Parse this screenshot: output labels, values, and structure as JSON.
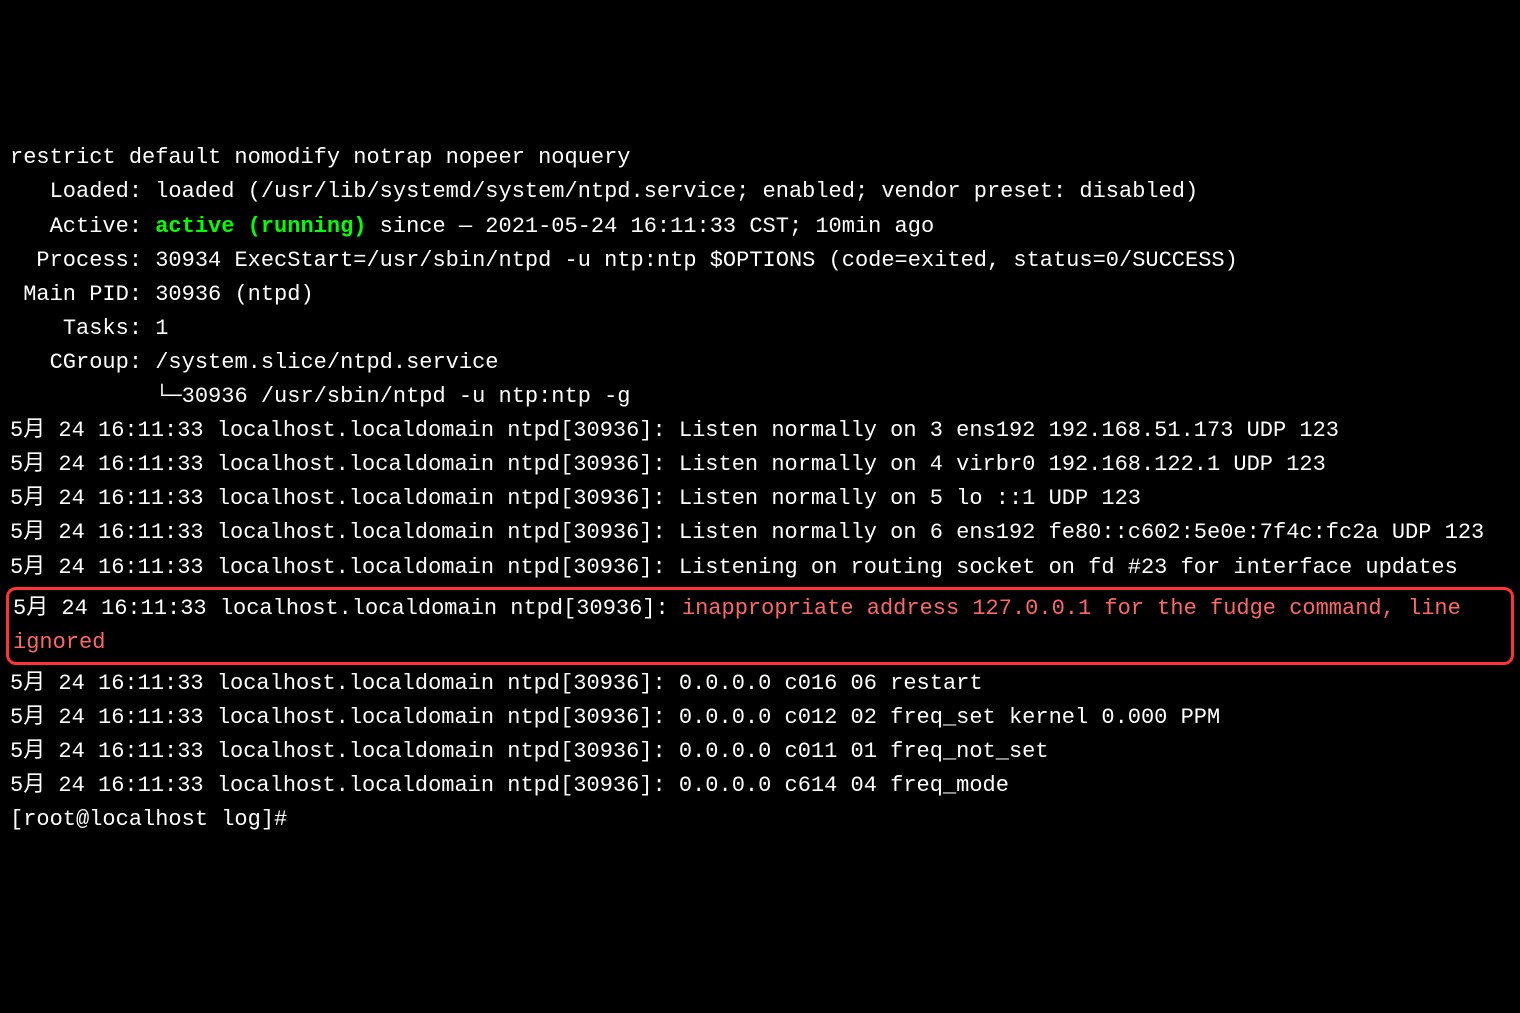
{
  "terminal": {
    "restrict_line": "restrict default nomodify notrap nopeer noquery",
    "loaded_label": "   Loaded: ",
    "loaded_value": "loaded (/usr/lib/systemd/system/ntpd.service; enabled; vendor preset: disabled)",
    "active_label": "   Active: ",
    "active_status": "active (running)",
    "active_since": " since — 2021-05-24 16:11:33 CST; 10min ago",
    "process_label": "  Process: ",
    "process_value": "30934 ExecStart=/usr/sbin/ntpd -u ntp:ntp $OPTIONS (code=exited, status=0/SUCCESS)",
    "mainpid_label": " Main PID: ",
    "mainpid_value": "30936 (ntpd)",
    "tasks_label": "    Tasks: ",
    "tasks_value": "1",
    "cgroup_label": "   CGroup: ",
    "cgroup_value": "/system.slice/ntpd.service",
    "cgroup_tree": "           └─30936 /usr/sbin/ntpd -u ntp:ntp -g",
    "blank": "",
    "log1": "5月 24 16:11:33 localhost.localdomain ntpd[30936]: Listen normally on 3 ens192 192.168.51.173 UDP 123",
    "log2": "5月 24 16:11:33 localhost.localdomain ntpd[30936]: Listen normally on 4 virbr0 192.168.122.1 UDP 123",
    "log3": "5月 24 16:11:33 localhost.localdomain ntpd[30936]: Listen normally on 5 lo ::1 UDP 123",
    "log4": "5月 24 16:11:33 localhost.localdomain ntpd[30936]: Listen normally on 6 ens192 fe80::c602:5e0e:7f4c:fc2a UDP 123",
    "log5": "5月 24 16:11:33 localhost.localdomain ntpd[30936]: Listening on routing socket on fd #23 for interface updates",
    "log6_prefix": "5月 24 16:11:33 localhost.localdomain ntpd[30936]: ",
    "log6_error": "inappropriate address 127.0.0.1 for the fudge command, line ignored",
    "log7": "5月 24 16:11:33 localhost.localdomain ntpd[30936]: 0.0.0.0 c016 06 restart",
    "log8": "5月 24 16:11:33 localhost.localdomain ntpd[30936]: 0.0.0.0 c012 02 freq_set kernel 0.000 PPM",
    "log9": "5月 24 16:11:33 localhost.localdomain ntpd[30936]: 0.0.0.0 c011 01 freq_not_set",
    "log10": "5月 24 16:11:33 localhost.localdomain ntpd[30936]: 0.0.0.0 c614 04 freq_mode",
    "prompt": "[root@localhost log]# "
  },
  "colors": {
    "bg": "#000000",
    "fg": "#ffffff",
    "green": "#00ff00",
    "red": "#ff6666",
    "highlight_border": "#ff3333"
  }
}
